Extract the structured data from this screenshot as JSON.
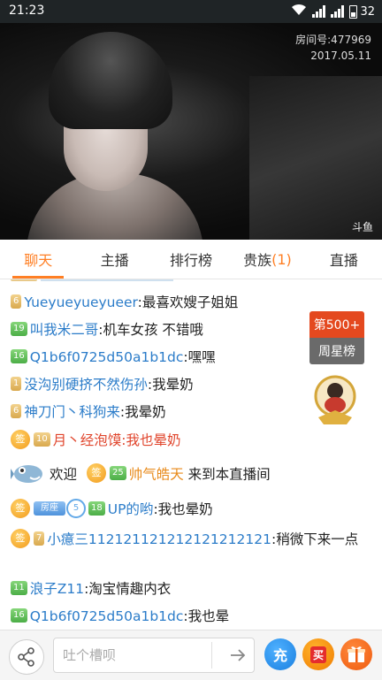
{
  "status_bar": {
    "time": "21:23",
    "battery": "32"
  },
  "video": {
    "room_id": "房间号:477969",
    "date": "2017.05.11",
    "logo": "斗鱼"
  },
  "tabs": [
    {
      "label": "聊天",
      "active": true
    },
    {
      "label": "主播"
    },
    {
      "label": "排行榜"
    },
    {
      "label": "贵族",
      "count": "(1)"
    },
    {
      "label": "直播"
    }
  ],
  "chat": [
    {
      "badge": "6",
      "name": "Yueyueyueyueer",
      "text": ":最喜欢嫂子姐姐"
    },
    {
      "badge": "19",
      "name": "叫我米二哥",
      "text": ":机车女孩 不错哦"
    },
    {
      "badge": "16",
      "name": "Q1b6f0725d50a1b1dc",
      "text": ":嘿嘿"
    },
    {
      "badge": "1",
      "name": "没沟别硬挤不然伤孙",
      "text": ":我晕奶"
    },
    {
      "badge": "6",
      "name": "神刀门丶科狗来",
      "text": ":我晕奶"
    },
    {
      "sign": "签",
      "badge": "10",
      "name": "月丶经泡馍",
      "text": ":我也晕奶"
    },
    {
      "welcome": "欢迎",
      "sign": "签",
      "badge": "25",
      "name": "帅气皓天",
      "text": "来到本直播间"
    },
    {
      "sign": "签",
      "tag": "房座",
      "medal": "5",
      "badge": "18",
      "name": "UP的哟",
      "text": ":我也晕奶"
    },
    {
      "sign": "签",
      "badge": "7",
      "name": "小癔三112121121212121212121",
      "text": ":稍微下来一点"
    },
    {
      "badge": "11",
      "name": "浪子Z11",
      "text": ":淘宝情趣内衣"
    },
    {
      "badge": "16",
      "name": "Q1b6f0725d50a1b1dc",
      "text": ":我也晕"
    }
  ],
  "rank_widget": {
    "rank": "第500+",
    "label": "周星榜"
  },
  "bottom_bar": {
    "input_placeholder": "吐个槽呗",
    "charge_label": "充",
    "buy_label": "买"
  }
}
